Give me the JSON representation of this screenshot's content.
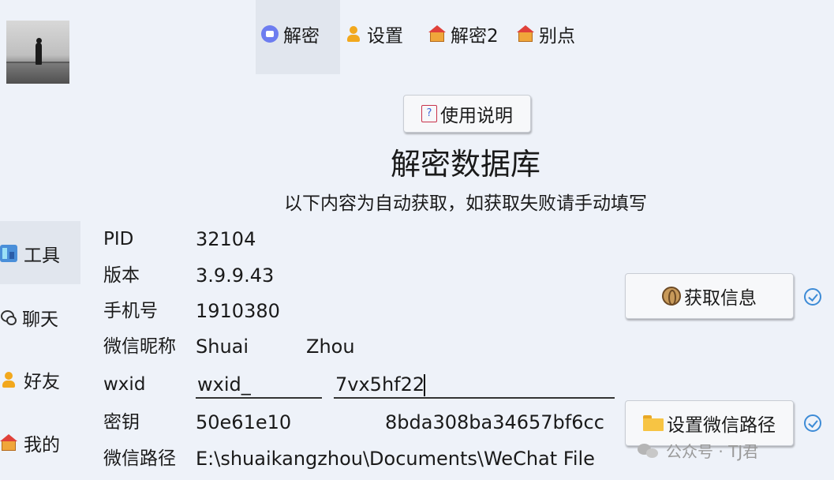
{
  "top_tabs": [
    {
      "label": "解密",
      "icon": "decrypt-icon",
      "active": true
    },
    {
      "label": "设置",
      "icon": "person-icon"
    },
    {
      "label": "解密2",
      "icon": "house-icon"
    },
    {
      "label": "别点",
      "icon": "house-icon"
    }
  ],
  "side_nav": [
    {
      "label": "工具",
      "icon": "tool-icon",
      "active": true
    },
    {
      "label": "聊天",
      "icon": "chat-icon"
    },
    {
      "label": "好友",
      "icon": "person-icon"
    },
    {
      "label": "我的",
      "icon": "house-icon"
    }
  ],
  "help_button": {
    "label": "使用说明",
    "icon": "question-icon",
    "icon_glyph": "?"
  },
  "title": "解密数据库",
  "subtitle": "以下内容为自动获取，如获取失败请手动填写",
  "fields": {
    "pid": {
      "label": "PID",
      "value": "32104"
    },
    "version": {
      "label": "版本",
      "value": "3.9.9.43"
    },
    "phone": {
      "label": "手机号",
      "value": "1910380"
    },
    "nickname": {
      "label": "微信昵称",
      "value_first": "Shuai",
      "value_last": "Zhou"
    },
    "wxid": {
      "label": "wxid",
      "value_left": "wxid_",
      "value_right": "7vx5hf22"
    },
    "key": {
      "label": "密钥",
      "value_left": "50e61e10",
      "value_right": "8bda308ba34657bf6cc"
    },
    "wechat_path": {
      "label": "微信路径",
      "value": "E:\\shuaikangzhou\\Documents\\WeChat File"
    }
  },
  "get_info_button": {
    "label": "获取信息",
    "icon": "globe-icon"
  },
  "set_path_button": {
    "label": "设置微信路径",
    "icon": "folder-icon"
  },
  "watermark": {
    "text": "公众号 · TJ君",
    "icon": "wechat-icon"
  },
  "colors": {
    "background": "#eef2f9",
    "active_tab": "#e1e6ee",
    "check": "#3d8bd6"
  }
}
